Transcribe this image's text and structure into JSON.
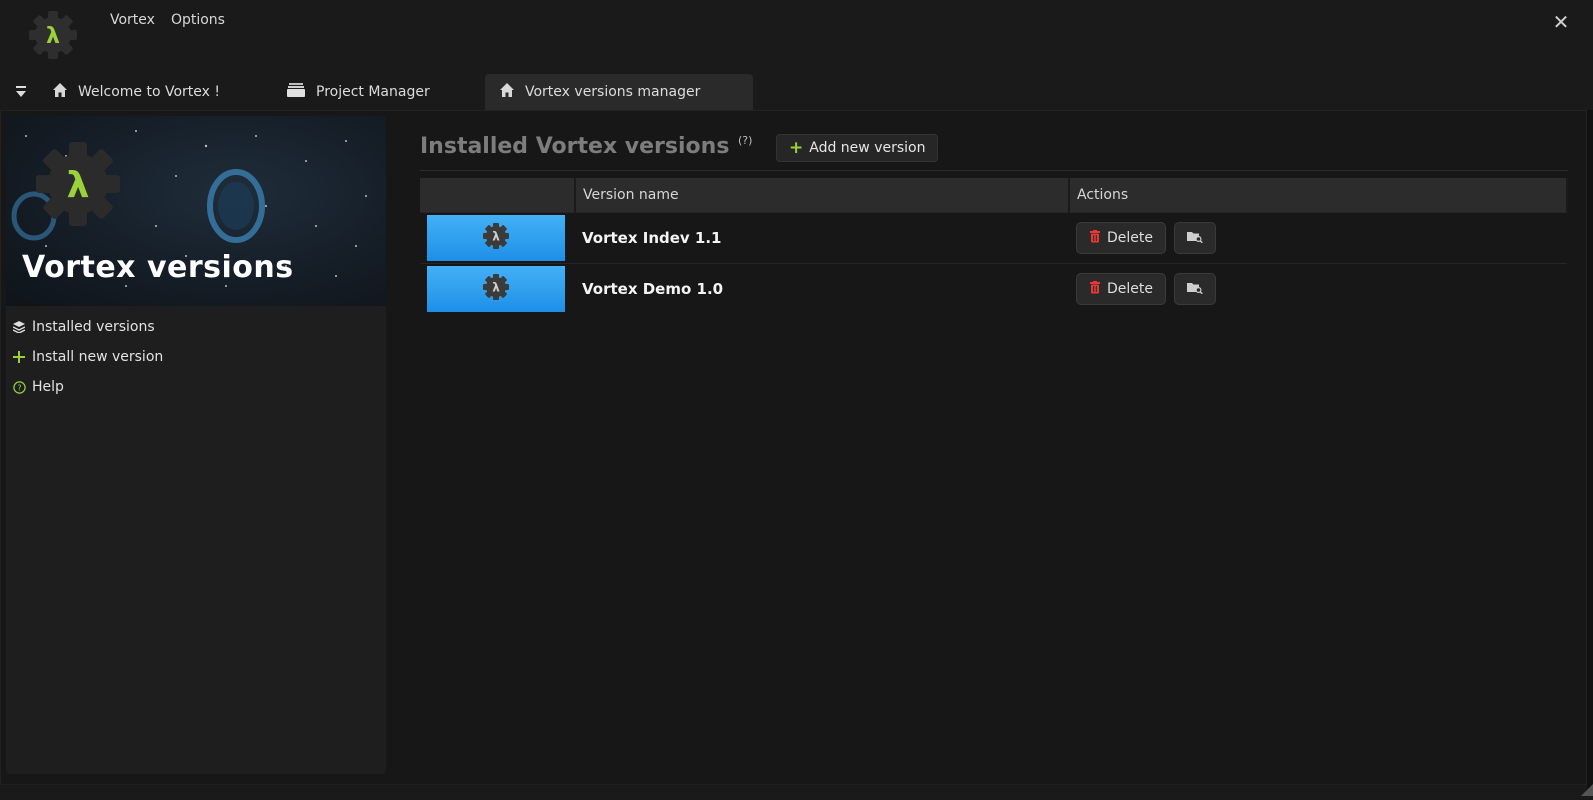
{
  "app": {
    "menu": [
      "Vortex",
      "Options"
    ],
    "accent_color": "#9bd23c"
  },
  "tabs": [
    {
      "label": "Welcome to Vortex !",
      "icon": "home-icon",
      "active": false
    },
    {
      "label": "Project Manager",
      "icon": "folders-icon",
      "active": false
    },
    {
      "label": "Vortex versions manager",
      "icon": "home-icon",
      "active": true
    }
  ],
  "sidebar": {
    "banner_title": "Vortex versions",
    "items": [
      {
        "label": "Installed versions",
        "icon": "layers-icon"
      },
      {
        "label": "Install new version",
        "icon": "plus-icon"
      },
      {
        "label": "Help",
        "icon": "help-circle-icon"
      }
    ]
  },
  "content": {
    "title": "Installed Vortex versions",
    "help_marker": "(?)",
    "add_button_label": "Add new version",
    "table": {
      "headers": [
        "",
        "Version name",
        "Actions"
      ],
      "rows": [
        {
          "name": "Vortex Indev 1.1",
          "delete_label": "Delete"
        },
        {
          "name": "Vortex Demo 1.0",
          "delete_label": "Delete"
        }
      ]
    }
  }
}
